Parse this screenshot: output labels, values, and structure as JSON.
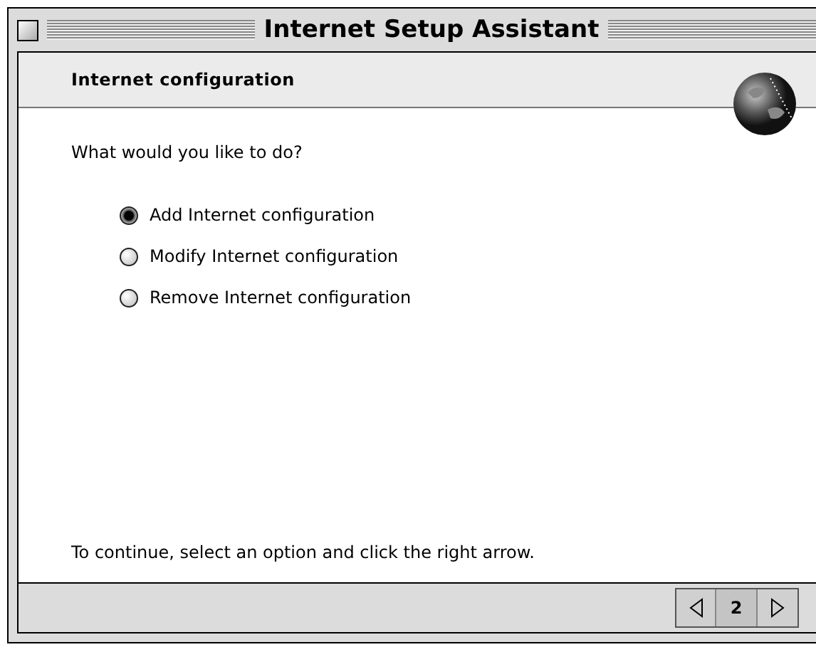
{
  "window": {
    "title": "Internet Setup Assistant"
  },
  "header": {
    "title": "Internet configuration"
  },
  "question": "What would you like to do?",
  "options": [
    {
      "label": "Add Internet configuration",
      "selected": true
    },
    {
      "label": "Modify Internet configuration",
      "selected": false
    },
    {
      "label": "Remove Internet configuration",
      "selected": false
    }
  ],
  "instruction": "To continue, select an option and click the right arrow.",
  "navigation": {
    "page": "2"
  }
}
